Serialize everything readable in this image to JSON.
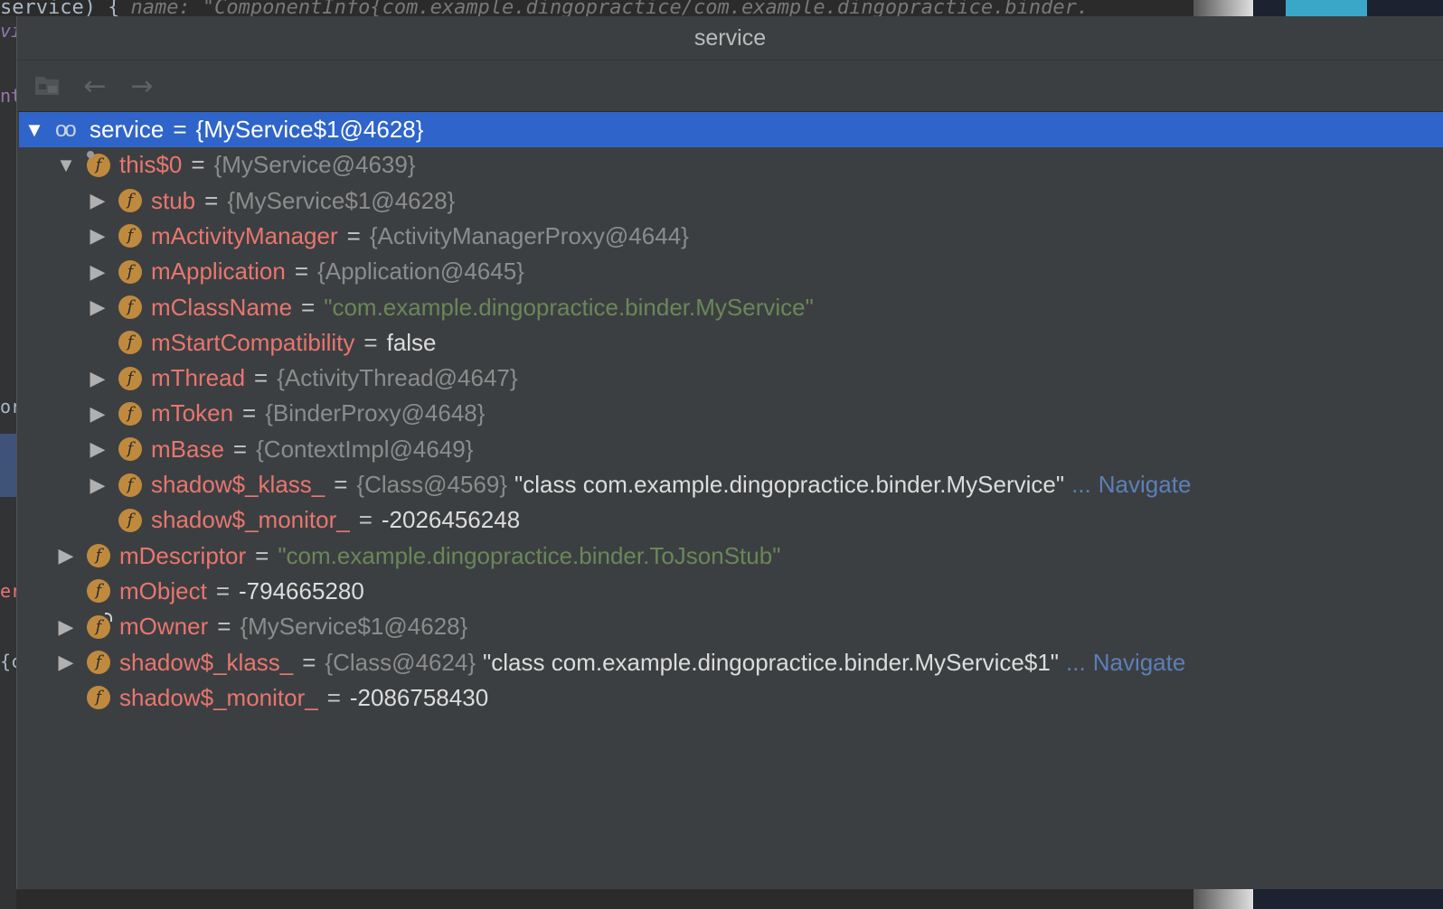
{
  "background": {
    "top_line": "service) {",
    "top_hint": "name: \"ComponentInfo{com.example.dingopractice/com.example.dingopractice.binder.",
    "left_fragments": [
      "vi",
      "nt",
      "or",
      "er(",
      "{c"
    ]
  },
  "popup": {
    "title": "service",
    "toolbar": {
      "jump_icon": "jump-to-source-icon",
      "back_icon": "back-arrow-icon",
      "forward_icon": "forward-arrow-icon",
      "back_glyph": "←",
      "forward_glyph": "→"
    }
  },
  "tree": [
    {
      "arrow": "▼",
      "icon": "watch",
      "name": "service",
      "eq": "=",
      "value": "{MyService$1@4628}",
      "value_kind": "ref",
      "selected": true
    },
    {
      "arrow": "▼",
      "icon": "field-mod",
      "name": "this$0",
      "eq": "=",
      "value": "{MyService@4639}",
      "value_kind": "ref"
    },
    {
      "arrow": "▶",
      "icon": "field",
      "name": "stub",
      "eq": "=",
      "value": "{MyService$1@4628}",
      "value_kind": "ref"
    },
    {
      "arrow": "▶",
      "icon": "field",
      "name": "mActivityManager",
      "eq": "=",
      "value": "{ActivityManagerProxy@4644}",
      "value_kind": "ref"
    },
    {
      "arrow": "▶",
      "icon": "field",
      "name": "mApplication",
      "eq": "=",
      "value": "{Application@4645}",
      "value_kind": "ref"
    },
    {
      "arrow": "▶",
      "icon": "field",
      "name": "mClassName",
      "eq": "=",
      "value": "\"com.example.dingopractice.binder.MyService\"",
      "value_kind": "str"
    },
    {
      "arrow": "",
      "icon": "field",
      "name": "mStartCompatibility",
      "eq": "=",
      "value": "false",
      "value_kind": "plain"
    },
    {
      "arrow": "▶",
      "icon": "field",
      "name": "mThread",
      "eq": "=",
      "value": "{ActivityThread@4647}",
      "value_kind": "ref"
    },
    {
      "arrow": "▶",
      "icon": "field",
      "name": "mToken",
      "eq": "=",
      "value": "{BinderProxy@4648}",
      "value_kind": "ref"
    },
    {
      "arrow": "▶",
      "icon": "field",
      "name": "mBase",
      "eq": "=",
      "value": "{ContextImpl@4649}",
      "value_kind": "ref"
    },
    {
      "arrow": "▶",
      "icon": "field",
      "name": "shadow$_klass_",
      "eq": "=",
      "value": "{Class@4569}",
      "value_kind": "ref",
      "extra": "\"class com.example.dingopractice.binder.MyService\"",
      "ellipsis": "...",
      "navigate": "Navigate"
    },
    {
      "arrow": "",
      "icon": "field",
      "name": "shadow$_monitor_",
      "eq": "=",
      "value": "-2026456248",
      "value_kind": "plain"
    },
    {
      "arrow": "▶",
      "icon": "field",
      "name": "mDescriptor",
      "eq": "=",
      "value": "\"com.example.dingopractice.binder.ToJsonStub\"",
      "value_kind": "str"
    },
    {
      "arrow": "",
      "icon": "field",
      "name": "mObject",
      "eq": "=",
      "value": "-794665280",
      "value_kind": "plain"
    },
    {
      "arrow": "▶",
      "icon": "field-mod2",
      "name": "mOwner",
      "eq": "=",
      "value": "{MyService$1@4628}",
      "value_kind": "ref"
    },
    {
      "arrow": "▶",
      "icon": "field",
      "name": "shadow$_klass_",
      "eq": "=",
      "value": "{Class@4624}",
      "value_kind": "ref",
      "extra": "\"class com.example.dingopractice.binder.MyService$1\"",
      "ellipsis": "...",
      "navigate": "Navigate"
    },
    {
      "arrow": "",
      "icon": "field",
      "name": "shadow$_monitor_",
      "eq": "=",
      "value": "-2086758430",
      "value_kind": "plain"
    }
  ],
  "colors": {
    "selection": "#2f65ca",
    "field_name": "#e8766f",
    "string_value": "#6a8759",
    "reference_value": "#8c8c8c",
    "link": "#5c7fb8",
    "field_icon": "#c08a3e"
  }
}
